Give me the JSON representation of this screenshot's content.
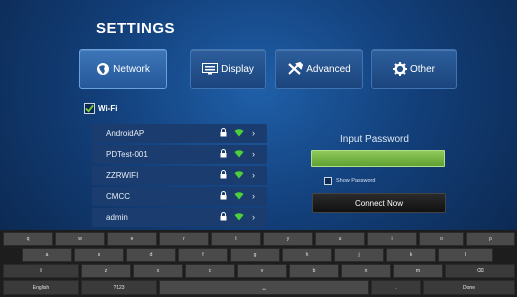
{
  "settings": {
    "title": "SETTINGS",
    "tabs": [
      {
        "label": "Network",
        "icon": "globe-icon",
        "active": true
      },
      {
        "label": "Display",
        "icon": "display-icon",
        "active": false
      },
      {
        "label": "Advanced",
        "icon": "tools-icon",
        "active": false
      },
      {
        "label": "Other",
        "icon": "gear-icon",
        "active": false
      }
    ]
  },
  "wifi": {
    "label": "Wi-Fi",
    "checked": true,
    "networks": [
      {
        "ssid": "AndroidAP"
      },
      {
        "ssid": "PDTest-001"
      },
      {
        "ssid": "ZZRWIFI"
      },
      {
        "ssid": "CMCC"
      },
      {
        "ssid": "admin"
      }
    ]
  },
  "password_panel": {
    "title": "Input Password",
    "input_value": "",
    "show_password_label": "Show Password",
    "connect_label": "Connect Now"
  },
  "keyboard": {
    "row1": [
      "q",
      "w",
      "e",
      "r",
      "t",
      "y",
      "u",
      "i",
      "o",
      "p"
    ],
    "row2": [
      "a",
      "s",
      "d",
      "f",
      "g",
      "h",
      "j",
      "k",
      "l"
    ],
    "row3": [
      "⇧",
      "z",
      "x",
      "c",
      "v",
      "b",
      "n",
      "m",
      "⌫"
    ],
    "row4": [
      "English",
      "?123",
      "␣",
      ".",
      "Done"
    ]
  },
  "colors": {
    "accent": "#2d5f9c",
    "input_green": "#7bbd4a"
  }
}
